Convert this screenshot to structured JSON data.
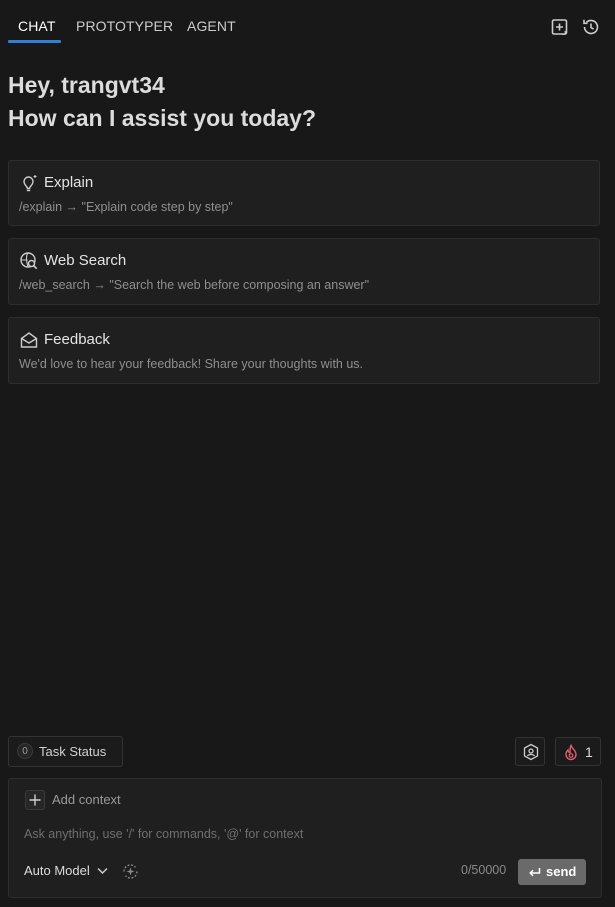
{
  "tabs": [
    {
      "label": "CHAT",
      "active": true
    },
    {
      "label": "PROTOTYPER",
      "active": false
    },
    {
      "label": "AGENT",
      "active": false
    }
  ],
  "header_icons": {
    "new_chat": "new-chat-icon",
    "history": "history-icon"
  },
  "greeting": {
    "line1": "Hey, trangvt34",
    "line2": "How can I assist you today?"
  },
  "cards": [
    {
      "title": "Explain",
      "desc": "/explain → \"Explain code step by step\"",
      "icon": "lightbulb-icon"
    },
    {
      "title": "Web Search",
      "desc": "/web_search → \"Search the web before composing an answer\"",
      "icon": "web-search-icon"
    },
    {
      "title": "Feedback",
      "desc": "We'd love to hear your feedback! Share your thoughts with us.",
      "icon": "mail-open-icon"
    }
  ],
  "task_status": {
    "count": "0",
    "label": "Task Status"
  },
  "flame_count": "1",
  "composer": {
    "add_context": "Add context",
    "placeholder": "Ask anything, use '/' for commands, '@' for context",
    "model": "Auto Model",
    "char_count": "0/50000",
    "send": "send"
  },
  "colors": {
    "accent": "#2f80d8",
    "background": "#181818",
    "card": "#1f1f1f",
    "send_button": "#6a6a6a",
    "flame": "#e0606e"
  }
}
